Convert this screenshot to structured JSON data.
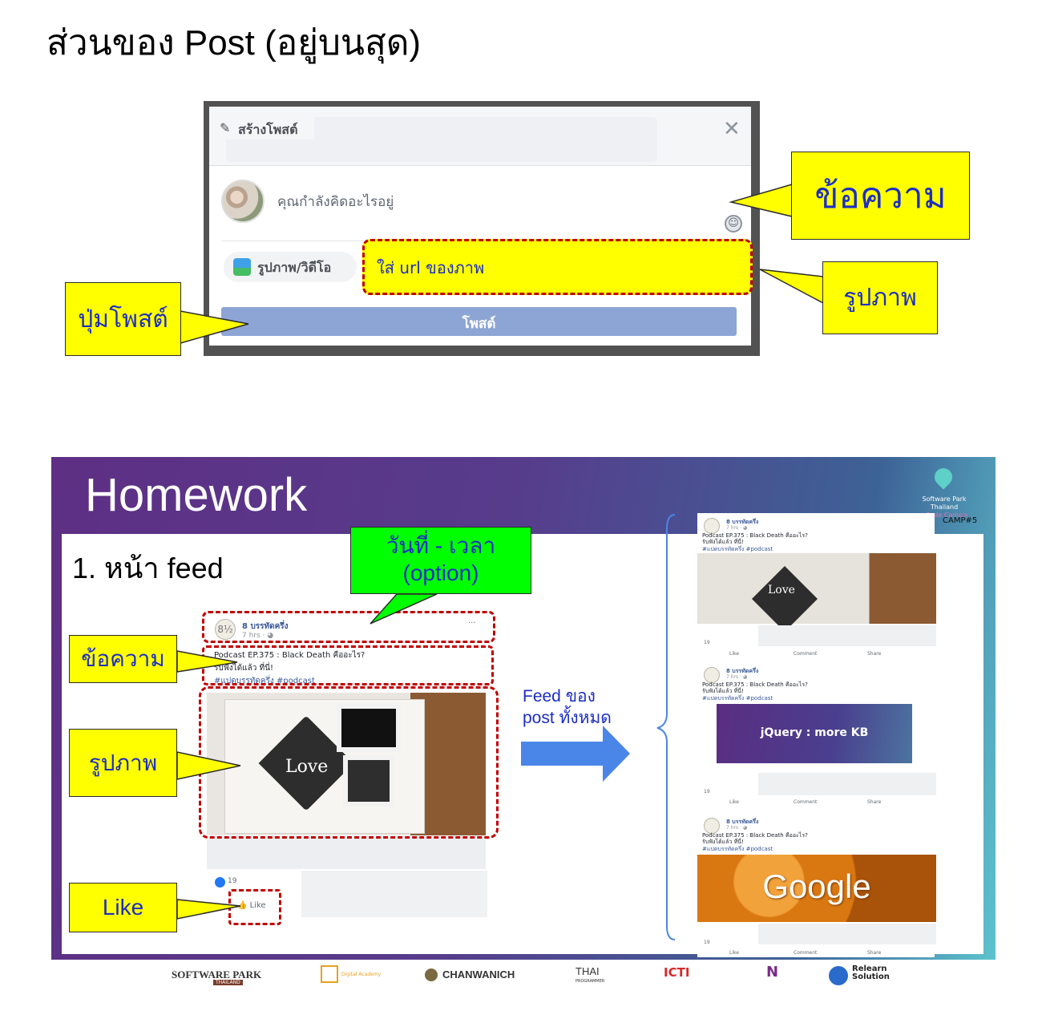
{
  "page_title": "ส่วนของ Post (อยู่บนสุด)",
  "create_post": {
    "header_label": "สร้างโพสต์",
    "status_placeholder": "คุณกำลังคิดอะไรอยู่",
    "photo_button_label": "รูปภาพ/วิดีโอ",
    "url_hint": "ใส่ url ของภาพ",
    "post_button_label": "โพสต์"
  },
  "callouts_top": {
    "message": "ข้อความ",
    "image": "รูปภาพ",
    "post_button": "ปุ่มโพสต์"
  },
  "slide": {
    "title": "Homework",
    "logo_line1": "Software Park Thailand",
    "logo_line2": "<Code Camp>",
    "camp_tag": "CAMP#5",
    "feed_heading": "1. หน้า feed",
    "date_callout_line1": "วันที่ - เวลา",
    "date_callout_line2": "(option)",
    "message_callout": "ข้อความ",
    "image_callout": "รูปภาพ",
    "like_callout": "Like",
    "feed_label_line1": "Feed ของ",
    "feed_label_line2": "post ทั้งหมด",
    "post": {
      "page_name": "8 บรรทัดครึ่ง",
      "time": "7 hrs · ◕",
      "more": "···",
      "text_line1": "Podcast EP.375 : Black Death คืออะไร?",
      "text_line2": "รับฟังได้แล้ว ที่นี่!",
      "tags": "#แปดบรรทัดครึ่ง #podcast",
      "image_caption": "Love",
      "like_count": "19",
      "like_label": "Like"
    },
    "feed_cards": [
      {
        "name": "8 บรรทัดครึ่ง",
        "time": "7 hrs · ◕",
        "line1": "Podcast EP.375 : Black Death คืออะไร?",
        "line2": "รับฟังได้แล้ว ที่นี่!",
        "tags": "#แปดบรรทัดครึ่ง #podcast",
        "image_text": "Love",
        "likes": "19",
        "like": "Like",
        "comment": "Comment",
        "share": "Share"
      },
      {
        "name": "8 บรรทัดครึ่ง",
        "time": "7 hrs · ◕",
        "line1": "Podcast EP.375 : Black Death คืออะไร?",
        "line2": "รับฟังได้แล้ว ที่นี่!",
        "tags": "#แปดบรรทัดครึ่ง #podcast",
        "image_text": "jQuery : more KB",
        "likes": "19",
        "like": "Like",
        "comment": "Comment",
        "share": "Share"
      },
      {
        "name": "8 บรรทัดครึ่ง",
        "time": "7 hrs · ◕",
        "line1": "Podcast EP.375 : Black Death คืออะไร?",
        "line2": "รับฟังได้แล้ว ที่นี่!",
        "tags": "#แปดบรรทัดครึ่ง #podcast",
        "image_text": "Google",
        "likes": "19",
        "like": "Like",
        "comment": "Comment",
        "share": "Share"
      }
    ],
    "footer_logos": [
      "SOFTWARE PARK",
      "THAILAND",
      "Digital Academy",
      "CHANWANICH",
      "THAI",
      "PROGRAMMER",
      "ICTI",
      "N",
      "Relearn",
      "Solution"
    ]
  },
  "colors": {
    "callout_yellow": "#ffff00",
    "callout_green": "#00ff00",
    "callout_text": "#1c2ec4",
    "dashed_red": "#c00000",
    "fb_blue": "#8da5d5",
    "arrow_blue": "#4a86e8"
  },
  "icons": [
    "pencil-icon",
    "close-icon",
    "emoji-icon",
    "photo-icon",
    "like-icon",
    "location-pin-icon",
    "arrow-right-icon"
  ]
}
